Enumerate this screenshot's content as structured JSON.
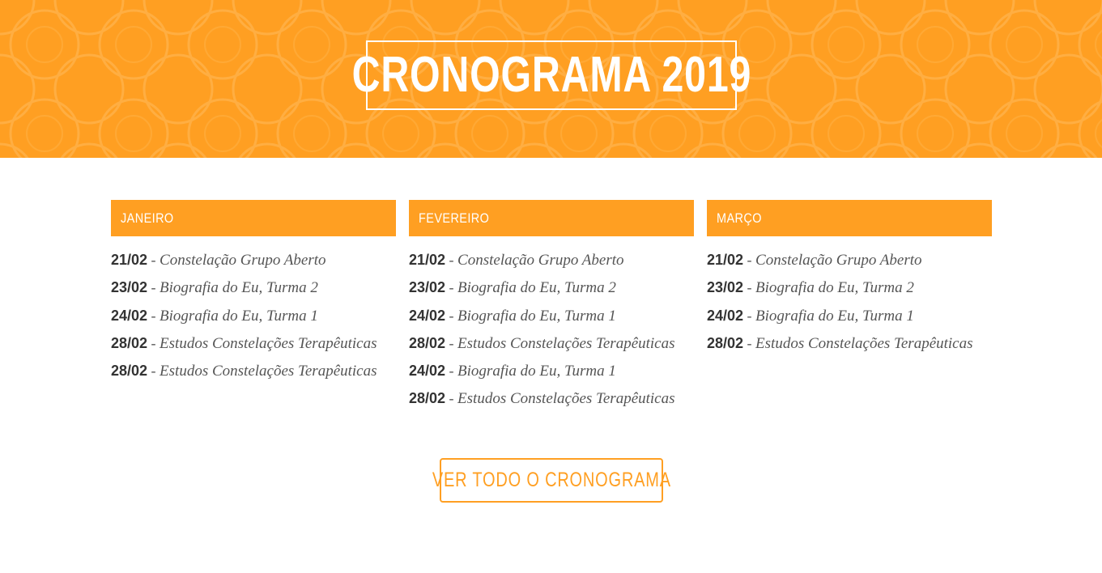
{
  "hero": {
    "title": "CRONOGRAMA 2019"
  },
  "months": [
    {
      "name": "JANEIRO",
      "items": [
        {
          "date": "21/02",
          "title": "Constelação Grupo Aberto"
        },
        {
          "date": "23/02",
          "title": "Biografia do Eu, Turma 2"
        },
        {
          "date": "24/02",
          "title": "Biografia do Eu, Turma 1"
        },
        {
          "date": "28/02",
          "title": "Estudos Constelações Terapêuticas"
        },
        {
          "date": "28/02",
          "title": "Estudos Constelações Terapêuticas"
        }
      ]
    },
    {
      "name": "FEVEREIRO",
      "items": [
        {
          "date": "21/02",
          "title": "Constelação Grupo Aberto"
        },
        {
          "date": "23/02",
          "title": "Biografia do Eu, Turma 2"
        },
        {
          "date": "24/02",
          "title": "Biografia do Eu, Turma 1"
        },
        {
          "date": "28/02",
          "title": "Estudos Constelações Terapêuticas"
        },
        {
          "date": "24/02",
          "title": "Biografia do Eu, Turma 1"
        },
        {
          "date": "28/02",
          "title": "Estudos Constelações Terapêuticas"
        }
      ]
    },
    {
      "name": "MARÇO",
      "items": [
        {
          "date": "21/02",
          "title": "Constelação Grupo Aberto"
        },
        {
          "date": "23/02",
          "title": "Biografia do Eu, Turma 2"
        },
        {
          "date": "24/02",
          "title": "Biografia do Eu, Turma 1"
        },
        {
          "date": "28/02",
          "title": "Estudos Constelações Terapêuticas"
        }
      ]
    }
  ],
  "cta": {
    "label": "VER TODO O CRONOGRAMA"
  },
  "colors": {
    "accent": "#ff9f22",
    "text": "#333333",
    "muted": "#555555",
    "background": "#ffffff"
  }
}
